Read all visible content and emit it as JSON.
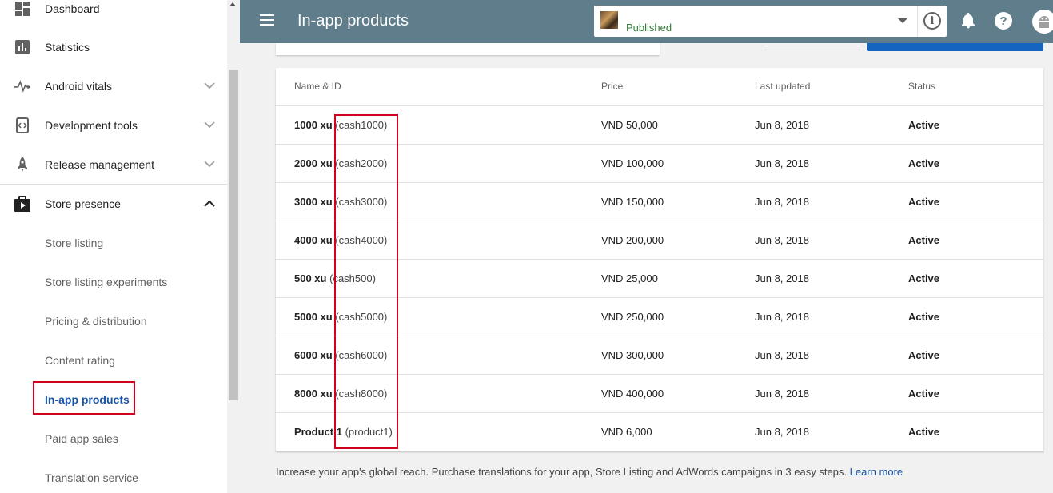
{
  "sidebar": {
    "items": [
      {
        "label": "Dashboard",
        "icon": "dashboard-icon"
      },
      {
        "label": "Statistics",
        "icon": "bar-chart-icon"
      },
      {
        "label": "Android vitals",
        "icon": "vitals-icon"
      },
      {
        "label": "Development tools",
        "icon": "code-icon"
      },
      {
        "label": "Release management",
        "icon": "rocket-icon"
      },
      {
        "label": "Store presence",
        "icon": "store-icon"
      }
    ],
    "subitems": [
      {
        "label": "Store listing"
      },
      {
        "label": "Store listing experiments"
      },
      {
        "label": "Pricing & distribution"
      },
      {
        "label": "Content rating"
      },
      {
        "label": "In-app products"
      },
      {
        "label": "Paid app sales"
      },
      {
        "label": "Translation service"
      }
    ]
  },
  "header": {
    "title": "In-app products",
    "app_status": "Published"
  },
  "table": {
    "headers": {
      "name": "Name & ID",
      "price": "Price",
      "updated": "Last updated",
      "status": "Status"
    },
    "rows": [
      {
        "name": "1000 xu",
        "id": "(cash1000)",
        "price": "VND 50,000",
        "updated": "Jun 8, 2018",
        "status": "Active"
      },
      {
        "name": "2000 xu",
        "id": "(cash2000)",
        "price": "VND 100,000",
        "updated": "Jun 8, 2018",
        "status": "Active"
      },
      {
        "name": "3000 xu",
        "id": "(cash3000)",
        "price": "VND 150,000",
        "updated": "Jun 8, 2018",
        "status": "Active"
      },
      {
        "name": "4000 xu",
        "id": "(cash4000)",
        "price": "VND 200,000",
        "updated": "Jun 8, 2018",
        "status": "Active"
      },
      {
        "name": "500 xu",
        "id": "(cash500)",
        "price": "VND 25,000",
        "updated": "Jun 8, 2018",
        "status": "Active"
      },
      {
        "name": "5000 xu",
        "id": "(cash5000)",
        "price": "VND 250,000",
        "updated": "Jun 8, 2018",
        "status": "Active"
      },
      {
        "name": "6000 xu",
        "id": "(cash6000)",
        "price": "VND 300,000",
        "updated": "Jun 8, 2018",
        "status": "Active"
      },
      {
        "name": "8000 xu",
        "id": "(cash8000)",
        "price": "VND 400,000",
        "updated": "Jun 8, 2018",
        "status": "Active"
      },
      {
        "name": "Product 1",
        "id": "(product1)",
        "price": "VND 6,000",
        "updated": "Jun 8, 2018",
        "status": "Active"
      }
    ]
  },
  "footer": {
    "text": "Increase your app's global reach. Purchase translations for your app, Store Listing and AdWords campaigns in 3 easy steps.",
    "link": "Learn more"
  },
  "colors": {
    "topbar": "#607d8b",
    "accent_link": "#1a56a8",
    "highlight_box": "#d0021b",
    "published": "#2e7d32"
  }
}
